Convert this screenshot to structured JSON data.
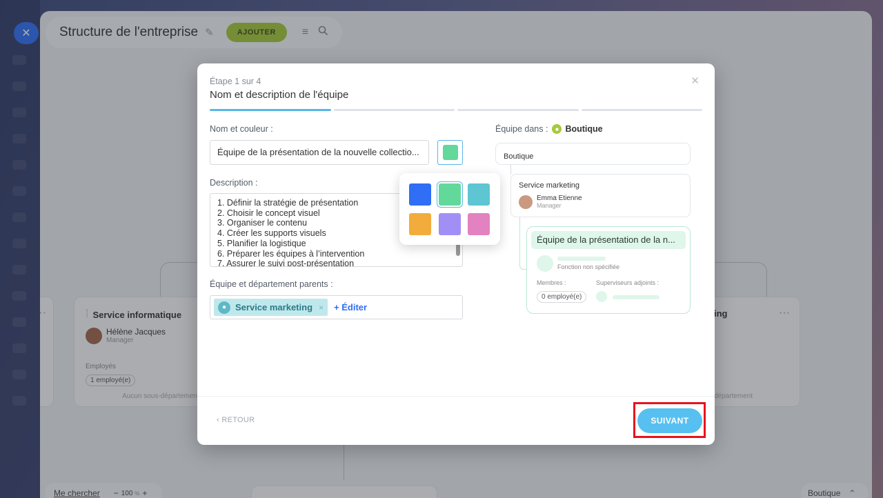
{
  "background": {
    "close_label": "✕",
    "page_title": "Structure de l'entreprise",
    "add_label": "AJOUTER",
    "card_left": {
      "name": "Service informatique",
      "manager_name": "Hélène Jacques",
      "manager_role": "Manager",
      "employees_label": "Employés",
      "employees_count": "1 employé(e)",
      "sub_label": "Aucun sous-département"
    },
    "card_right": {
      "name_fragment": "ing",
      "sub_fragment": "département"
    },
    "zoom": {
      "find_me": "Me chercher",
      "minus": "−",
      "value": "100",
      "unit": "%",
      "plus": "+"
    },
    "crumb": {
      "label": "Boutique",
      "up_icon": "⌃"
    }
  },
  "modal": {
    "step": "Étape 1 sur 4",
    "title": "Nom et description de l'équipe",
    "close": "✕",
    "name_label": "Nom et couleur :",
    "name_value": "Équipe de la présentation de la nouvelle collectio...",
    "color_selected": "#62d89a",
    "palette": [
      "#2f6ef5",
      "#62d89a",
      "#5ec5d3",
      "#f2ac3b",
      "#a28ff5",
      "#e382c0"
    ],
    "description_label": "Description :",
    "description_lines": [
      "1. Définir la stratégie de présentation",
      "2. Choisir le concept visuel",
      "3. Organiser le contenu",
      "4. Créer les supports visuels",
      "5. Planifier la logistique",
      "6. Préparer les équipes à l’intervention",
      "7. Assurer le suivi post-présentation"
    ],
    "parents_label": "Équipe et département parents :",
    "parent_tag": "Service marketing",
    "parent_tag_remove": "×",
    "edit_label": "+ Éditer",
    "back_label": "RETOUR",
    "next_label": "SUIVANT",
    "preview": {
      "in_label": "Équipe dans :",
      "in_value": "Boutique",
      "root": "Boutique",
      "dept_name": "Service marketing",
      "dept_manager": "Emma Etienne",
      "dept_manager_role": "Manager",
      "team_name": "Équipe de la présentation de la n...",
      "no_role": "Fonction non spécifiée",
      "members_label": "Membres :",
      "members_value": "0 employé(e)",
      "deputies_label": "Superviseurs adjoints :"
    }
  }
}
